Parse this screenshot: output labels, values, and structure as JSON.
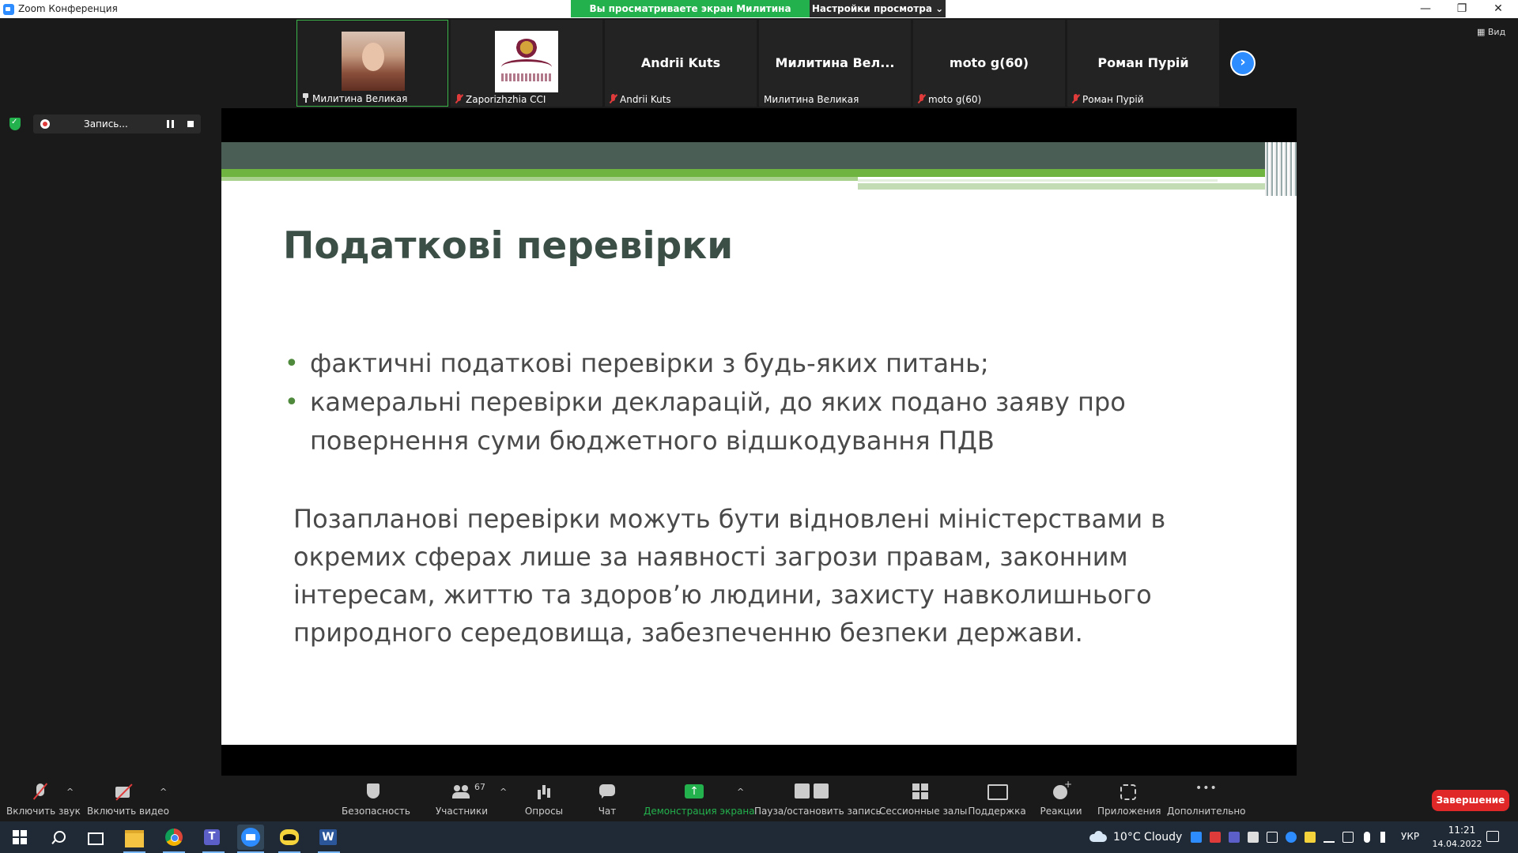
{
  "window": {
    "title": "Zoom Конференция",
    "view_banner": "Вы просматриваете экран Милитина Великая",
    "view_settings": "Настройки просмотра ⌄",
    "controls": {
      "minimize": "—",
      "restore": "❐",
      "close": "✕"
    }
  },
  "participants": [
    {
      "display": "",
      "label": "Милитина Великая",
      "has_photo": true,
      "active": true,
      "icon": "pin-icon"
    },
    {
      "display": "",
      "label": "Zaporizhzhia CCI",
      "has_logo": true,
      "icon": "muted-mic-icon"
    },
    {
      "display": "Andrii Kuts",
      "label": "Andrii Kuts",
      "icon": "muted-mic-icon"
    },
    {
      "display": "Милитина  Вел...",
      "label": "Милитина Великая",
      "icon": ""
    },
    {
      "display": "moto g(60)",
      "label": "moto g(60)",
      "icon": "muted-mic-icon"
    },
    {
      "display": "Роман Пурій",
      "label": "Роман Пурій",
      "icon": "muted-mic-icon"
    }
  ],
  "strip": {
    "next_glyph": "›",
    "view_label": "▦ Вид"
  },
  "recording": {
    "label": "Запись..."
  },
  "slide": {
    "title": "Податкові перевірки",
    "bullets": [
      "фактичні податкові перевірки з будь-яких питань;",
      "камеральні перевірки декларацій, до яких подано заяву про повернення суми бюджетного відшкодування ПДВ"
    ],
    "paragraph": "Позапланові перевірки можуть бути відновлені міністерствами в окремих сферах лише за наявності загрози правам, законним інтересам, життю та здоров’ю людини, захисту навколишнього природного середовища, забезпеченню безпеки держави."
  },
  "toolbar": {
    "audio": "Включить звук",
    "video": "Включить видео",
    "security": "Безопасность",
    "participants": "Участники",
    "participants_count": "67",
    "polls": "Опросы",
    "chat": "Чат",
    "share": "Демонстрация экрана",
    "record": "Пауза/остановить запись",
    "rooms": "Сессионные залы",
    "support": "Поддержка",
    "reactions": "Реакции",
    "apps": "Приложения",
    "more": "Дополнительно",
    "end": "Завершение",
    "caret": "^"
  },
  "taskbar": {
    "weather": "10°C  Cloudy",
    "language": "УКР",
    "time": "11:21",
    "date": "14.04.2022"
  },
  "colors": {
    "accent_green": "#23b14d",
    "zoom_blue": "#2d8cff",
    "end_red": "#e02828",
    "slide_title": "#3c4f47",
    "slide_bar": "#6fb341"
  }
}
